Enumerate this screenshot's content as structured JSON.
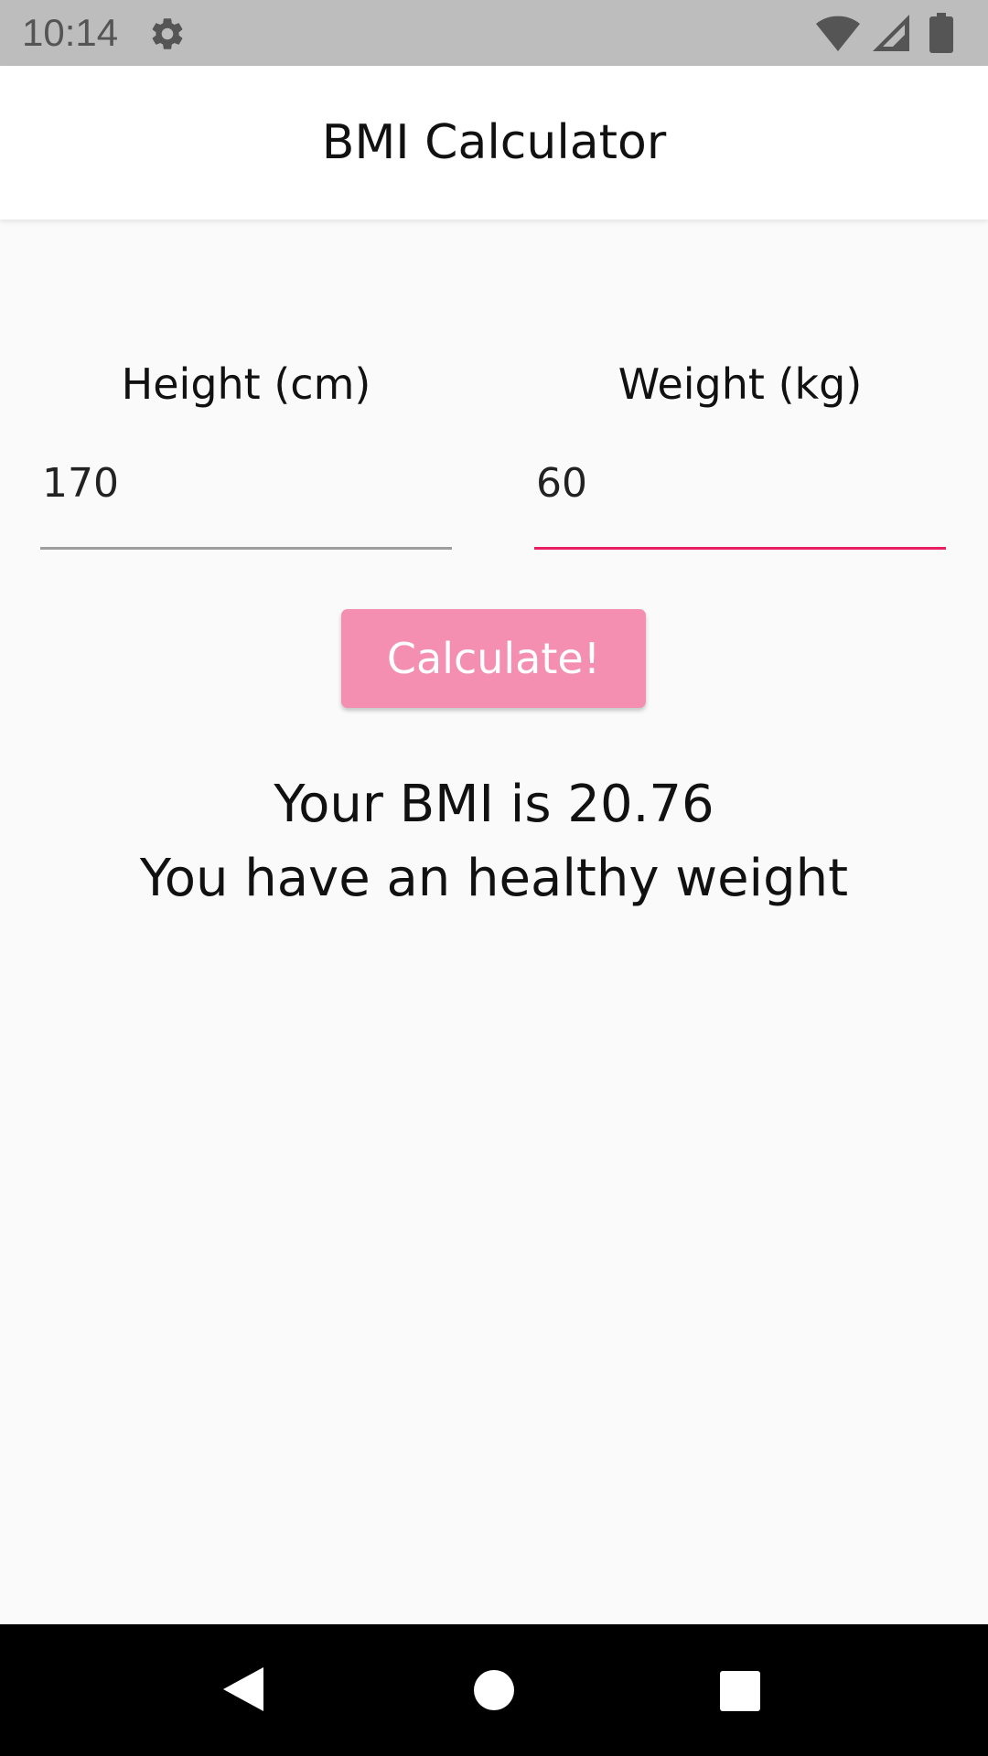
{
  "status_bar": {
    "time": "10:14",
    "icons": [
      "settings-gear-icon",
      "wifi-icon",
      "cellular-signal-icon",
      "battery-icon"
    ]
  },
  "app_bar": {
    "title": "BMI Calculator"
  },
  "form": {
    "height_label": "Height (cm)",
    "height_value": "170",
    "weight_label": "Weight (kg)",
    "weight_value": "60"
  },
  "calculate_button": {
    "label": "Calculate!"
  },
  "result": {
    "bmi_line": "Your BMI is 20.76",
    "verdict_line": "You have an healthy weight"
  },
  "nav_bar": {
    "icons": [
      "back-icon",
      "home-icon",
      "recents-icon"
    ]
  },
  "colors": {
    "accent": "#e91e63",
    "button": "#f48fb1",
    "status_bar": "#bdbdbd",
    "background": "#fafafa"
  }
}
